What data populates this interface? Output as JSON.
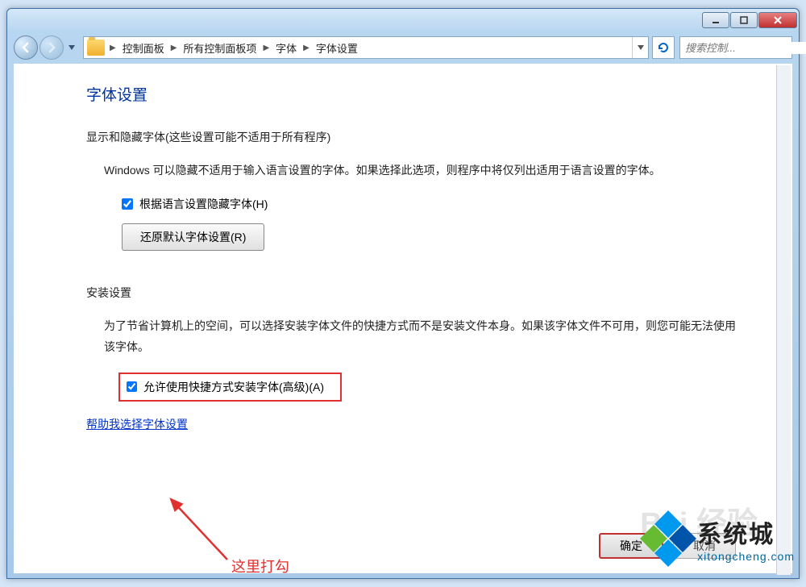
{
  "breadcrumb": {
    "items": [
      "控制面板",
      "所有控制面板项",
      "字体",
      "字体设置"
    ]
  },
  "search": {
    "placeholder": "搜索控制..."
  },
  "page": {
    "title": "字体设置",
    "section1": {
      "heading": "显示和隐藏字体(这些设置可能不适用于所有程序)",
      "body": "Windows 可以隐藏不适用于输入语言设置的字体。如果选择此选项，则程序中将仅列出适用于语言设置的字体。",
      "checkbox_label": "根据语言设置隐藏字体(H)",
      "checkbox_checked": true,
      "restore_button": "还原默认字体设置(R)"
    },
    "section2": {
      "heading": "安装设置",
      "body": "为了节省计算机上的空间，可以选择安装字体文件的快捷方式而不是安装文件本身。如果该字体文件不可用，则您可能无法使用该字体。",
      "checkbox_label": "允许使用快捷方式安装字体(高级)(A)",
      "checkbox_checked": true
    },
    "help_link": "帮助我选择字体设置",
    "annotation": "这里打勾",
    "ok_button": "确定",
    "cancel_button": "取消"
  },
  "watermark": {
    "brand_cn": "系统城",
    "brand_en": "xitongcheng.com"
  }
}
